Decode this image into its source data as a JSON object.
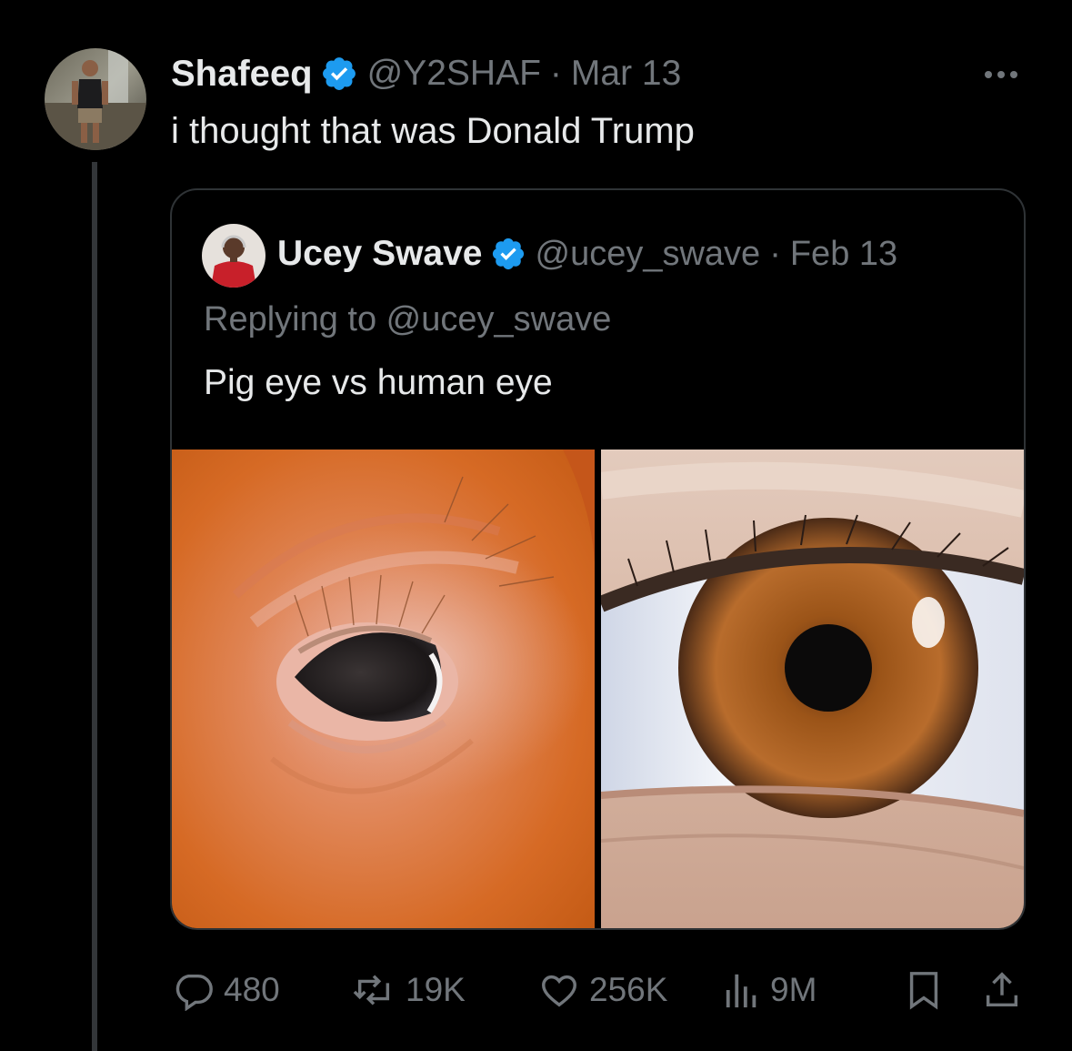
{
  "tweet": {
    "author_name": "Shafeeq",
    "author_handle": "@Y2SHAF",
    "separator": "·",
    "date": "Mar 13",
    "text": "i thought that was Donald Trump"
  },
  "quoted_tweet": {
    "author_name": "Ucey Swave",
    "author_handle": "@ucey_swave",
    "separator": "·",
    "date": "Feb 13",
    "replying_to_label": "Replying to @ucey_swave",
    "text": "Pig eye vs human eye",
    "media": [
      "pig eye close-up photo",
      "human eye close-up photo"
    ]
  },
  "actions": {
    "replies": "480",
    "reposts": "19K",
    "likes": "256K",
    "views": "9M"
  },
  "icons": [
    "verified-badge-icon",
    "more-icon",
    "reply-icon",
    "repost-icon",
    "like-icon",
    "views-icon",
    "bookmark-icon",
    "share-icon"
  ],
  "colors": {
    "background": "#000000",
    "text_primary": "#e7e9ea",
    "text_secondary": "#71767b",
    "verified_blue": "#1d9bf0",
    "border": "#2f3336"
  }
}
